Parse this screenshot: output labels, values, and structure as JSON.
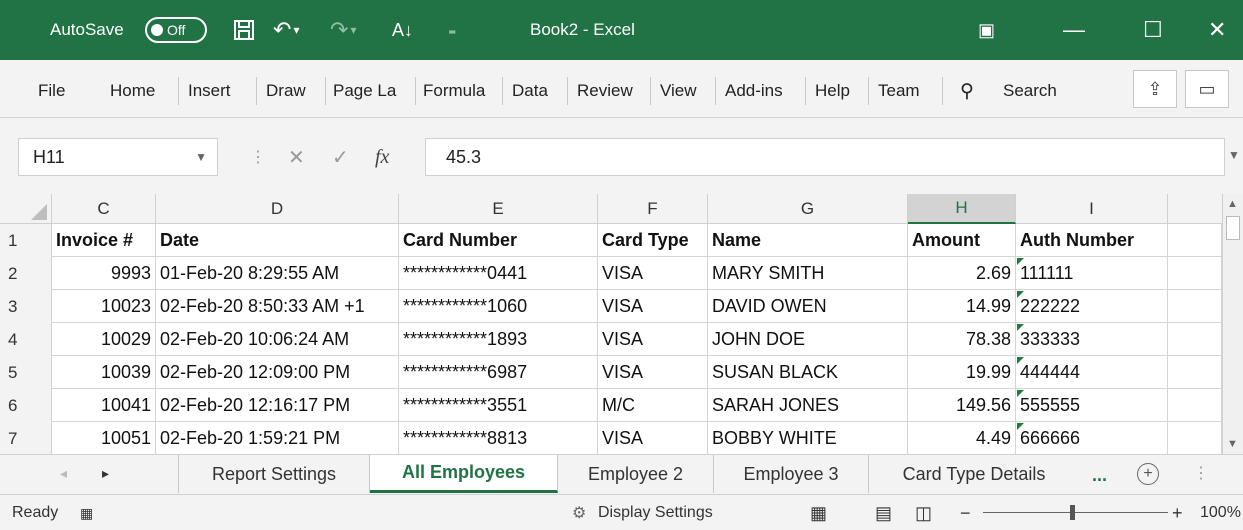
{
  "titlebar": {
    "autosave_label": "AutoSave",
    "autosave_state": "Off",
    "title": "Book2 - Excel",
    "color": "#217346"
  },
  "ribbon": {
    "tabs": [
      "File",
      "Home",
      "Insert",
      "Draw",
      "Page La",
      "Formula",
      "Data",
      "Review",
      "View",
      "Add-ins",
      "Help",
      "Team"
    ],
    "search_label": "Search"
  },
  "formula_bar": {
    "name_box": "H11",
    "fx": "fx",
    "value": "45.3"
  },
  "grid": {
    "columns": [
      "C",
      "D",
      "E",
      "F",
      "G",
      "H",
      "I"
    ],
    "selected_column": "H",
    "row_numbers": [
      "1",
      "2",
      "3",
      "4",
      "5",
      "6",
      "7"
    ],
    "header": [
      "Invoice #",
      "Date",
      "Card Number",
      "Card Type",
      "Name",
      "Amount",
      "Auth Number"
    ],
    "rows": [
      [
        "9993",
        "01-Feb-20 8:29:55 AM",
        "************0441",
        "VISA",
        "MARY SMITH",
        "2.69",
        "111111"
      ],
      [
        "10023",
        "02-Feb-20 8:50:33 AM +1",
        "************1060",
        "VISA",
        "DAVID OWEN",
        "14.99",
        "222222"
      ],
      [
        "10029",
        "02-Feb-20 10:06:24 AM",
        "************1893",
        "VISA",
        "JOHN DOE",
        "78.38",
        "333333"
      ],
      [
        "10039",
        "02-Feb-20 12:09:00 PM",
        "************6987",
        "VISA",
        "SUSAN BLACK",
        "19.99",
        "444444"
      ],
      [
        "10041",
        "02-Feb-20 12:16:17 PM",
        "************3551",
        "M/C",
        "SARAH JONES",
        "149.56",
        "555555"
      ],
      [
        "10051",
        "02-Feb-20 1:59:21 PM",
        "************8813",
        "VISA",
        "BOBBY WHITE",
        "4.49",
        "666666"
      ]
    ]
  },
  "sheets": {
    "tabs": [
      "Report Settings",
      "All Employees",
      "Employee 2",
      "Employee 3",
      "Card Type Details"
    ],
    "active": "All Employees",
    "more": "..."
  },
  "status": {
    "ready": "Ready",
    "display_settings": "Display Settings",
    "zoom": "100%"
  }
}
